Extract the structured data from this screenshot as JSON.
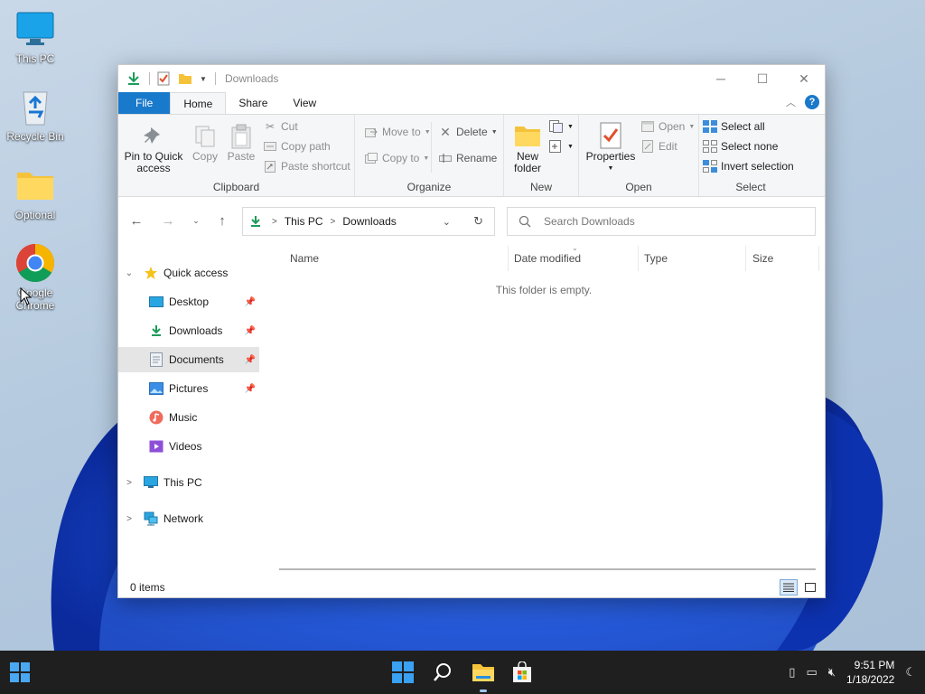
{
  "desktop": {
    "icons": [
      {
        "label": "This PC"
      },
      {
        "label": "Recycle Bin"
      },
      {
        "label": "Optional"
      },
      {
        "label": "Google\nChrome",
        "line1": "Google",
        "line2": "Chrome"
      }
    ]
  },
  "window": {
    "title": "Downloads",
    "tabs": [
      "File",
      "Home",
      "Share",
      "View"
    ],
    "ribbon": {
      "clipboard": {
        "label": "Clipboard",
        "pin_line1": "Pin to Quick",
        "pin_line2": "access",
        "copy": "Copy",
        "paste": "Paste",
        "cut": "Cut",
        "copy_path": "Copy path",
        "paste_shortcut": "Paste shortcut"
      },
      "organize": {
        "label": "Organize",
        "move_to": "Move to",
        "copy_to": "Copy to",
        "delete": "Delete",
        "rename": "Rename"
      },
      "new": {
        "label": "New",
        "new_folder_line1": "New",
        "new_folder_line2": "folder"
      },
      "open": {
        "label": "Open",
        "properties": "Properties",
        "open": "Open",
        "edit": "Edit"
      },
      "select": {
        "label": "Select",
        "select_all": "Select all",
        "select_none": "Select none",
        "invert_selection": "Invert selection"
      }
    },
    "address": {
      "crumbs": [
        "This PC",
        "Downloads"
      ],
      "search_placeholder": "Search Downloads"
    },
    "navpane": {
      "quick_access": "Quick access",
      "items": [
        {
          "label": "Desktop",
          "pinned": true
        },
        {
          "label": "Downloads",
          "pinned": true
        },
        {
          "label": "Documents",
          "pinned": true,
          "selected": true
        },
        {
          "label": "Pictures",
          "pinned": true
        },
        {
          "label": "Music",
          "pinned": false
        },
        {
          "label": "Videos",
          "pinned": false
        }
      ],
      "this_pc": "This PC",
      "network": "Network"
    },
    "columns": [
      "Name",
      "Date modified",
      "Type",
      "Size"
    ],
    "empty_message": "This folder is empty.",
    "status": "0 items"
  },
  "taskbar": {
    "time": "9:51 PM",
    "date": "1/18/2022"
  },
  "colors": {
    "accent": "#1979ca",
    "taskbar": "#1f1f1f"
  }
}
